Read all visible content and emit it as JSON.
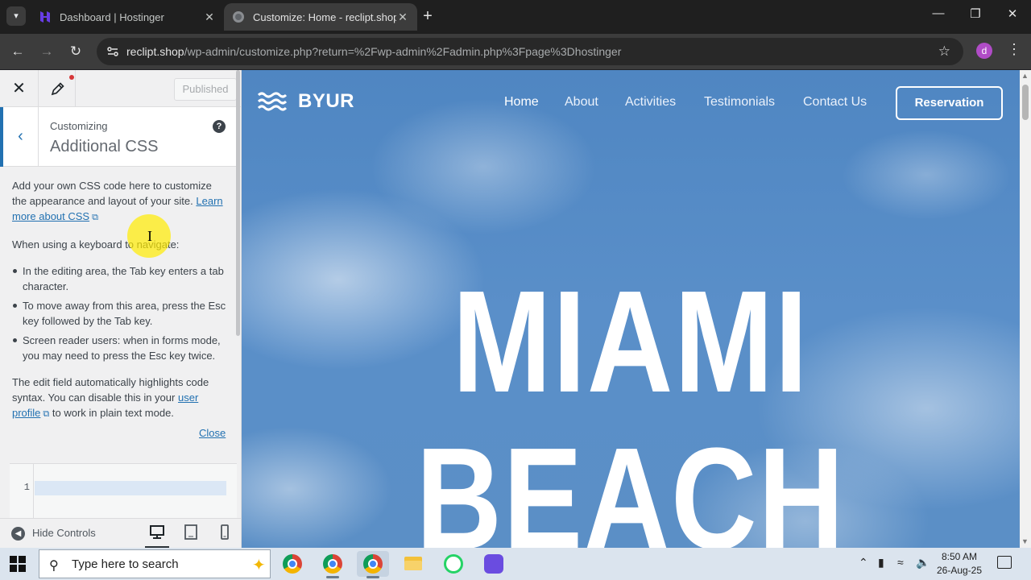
{
  "browser": {
    "tabs": [
      {
        "title": "Dashboard | Hostinger",
        "favicon": "hostinger-icon"
      },
      {
        "title": "Customize: Home - reclipt.shop",
        "favicon": "globe-icon"
      }
    ],
    "url_host": "reclipt.shop",
    "url_path": "/wp-admin/customize.php?return=%2Fwp-admin%2Fadmin.php%3Fpage%3Dhostinger",
    "profile_initial": "d"
  },
  "customizer": {
    "published_label": "Published",
    "customizing_label": "Customizing",
    "section_title": "Additional CSS",
    "help_label": "?",
    "intro_text": "Add your own CSS code here to customize the appearance and layout of your site.",
    "learn_more_link": "Learn more about CSS",
    "keyboard_heading": "When using a keyboard to navigate:",
    "tips": [
      "In the editing area, the Tab key enters a tab character.",
      "To move away from this area, press the Esc key followed by the Tab key.",
      "Screen reader users: when in forms mode, you may need to press the Esc key twice."
    ],
    "highlight_text_1": "The edit field automatically highlights code syntax. You can disable this in your",
    "user_profile_link": "user profile",
    "highlight_text_2": "to work in plain text mode.",
    "close_link": "Close",
    "editor_line_number": "1",
    "hide_controls_label": "Hide Controls"
  },
  "site": {
    "logo_text": "BYUR",
    "nav": [
      "Home",
      "About",
      "Activities",
      "Testimonials",
      "Contact Us"
    ],
    "reservation_button": "Reservation",
    "hero_line1": "MIAMI",
    "hero_line2": "BEACH"
  },
  "taskbar": {
    "search_placeholder": "Type here to search",
    "time": "8:50 AM",
    "date": "26-Aug-25"
  },
  "colors": {
    "wp_blue": "#2271b1",
    "sky": "#5a8fc9",
    "chrome_dark": "#3c3c3c"
  }
}
